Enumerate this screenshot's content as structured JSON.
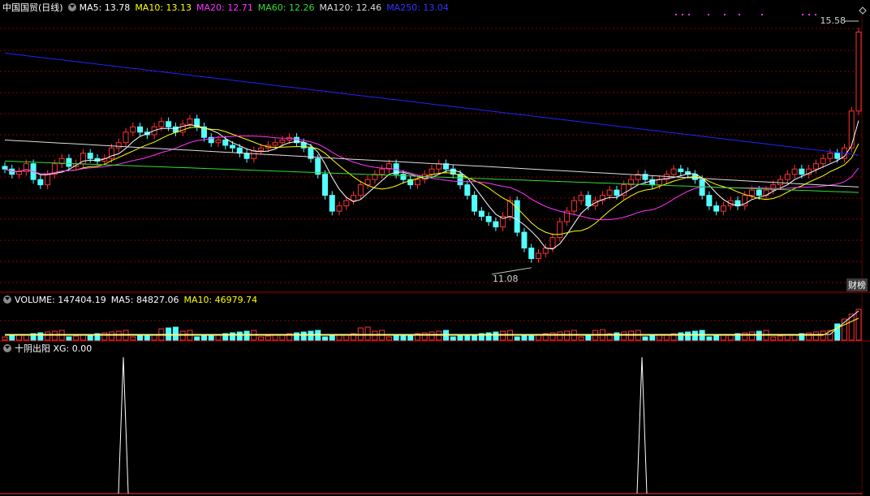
{
  "main_header": {
    "title": "中国国贸(日线)",
    "ma": [
      {
        "label": "MA5: 13.78",
        "color": "#ffffff"
      },
      {
        "label": "MA10: 13.13",
        "color": "#ffff00"
      },
      {
        "label": "MA20: 12.71",
        "color": "#ff33ff"
      },
      {
        "label": "MA60: 12.26",
        "color": "#33dd33"
      },
      {
        "label": "MA120: 12.46",
        "color": "#dddddd"
      },
      {
        "label": "MA250: 13.04",
        "color": "#3333ff"
      }
    ]
  },
  "price_labels": {
    "high": "15.58",
    "low": "11.08"
  },
  "badge": "财榜",
  "volume_header": {
    "items": [
      {
        "label": "VOLUME: 147404.19",
        "color": "#ffffff"
      },
      {
        "label": "MA5: 84827.06",
        "color": "#ffffff"
      },
      {
        "label": "MA10: 46979.74",
        "color": "#ffff00"
      }
    ]
  },
  "indicator_header": {
    "label": "十阴出阳 XG: 0.00"
  },
  "colors": {
    "up": "#ff3232",
    "down": "#54ffff",
    "grid": "#8b0000",
    "ma5": "#ffffff",
    "ma10": "#ffff00",
    "ma20": "#ff33ff",
    "ma60": "#33dd33",
    "ma120": "#dddddd",
    "ma250": "#2222ff"
  },
  "chart_data": {
    "type": "line",
    "title": "中国国贸(日线)",
    "series_summary": [
      {
        "name": "MA5",
        "last": 13.78
      },
      {
        "name": "MA10",
        "last": 13.13
      },
      {
        "name": "MA20",
        "last": 12.71
      },
      {
        "name": "MA60",
        "last": 12.26
      },
      {
        "name": "MA120",
        "last": 12.46
      },
      {
        "name": "MA250",
        "last": 13.04
      }
    ],
    "annotated_high": 15.58,
    "annotated_low": 11.08,
    "closes": [
      12.8,
      12.7,
      12.75,
      12.9,
      12.6,
      12.5,
      12.7,
      12.9,
      13.0,
      12.85,
      12.9,
      13.1,
      13.0,
      12.95,
      13.0,
      13.2,
      13.3,
      13.5,
      13.6,
      13.5,
      13.45,
      13.6,
      13.7,
      13.6,
      13.5,
      13.65,
      13.75,
      13.6,
      13.4,
      13.3,
      13.35,
      13.25,
      13.2,
      13.1,
      13.0,
      13.15,
      13.2,
      13.25,
      13.3,
      13.35,
      13.4,
      13.3,
      13.2,
      13.0,
      12.7,
      12.3,
      12.0,
      12.1,
      12.2,
      12.3,
      12.5,
      12.6,
      12.7,
      12.8,
      12.9,
      12.7,
      12.6,
      12.5,
      12.6,
      12.7,
      12.8,
      12.9,
      12.8,
      12.7,
      12.5,
      12.3,
      12.0,
      11.9,
      11.8,
      11.7,
      11.9,
      12.2,
      11.6,
      11.3,
      11.1,
      11.2,
      11.3,
      11.5,
      11.8,
      12.0,
      12.2,
      12.3,
      12.1,
      12.2,
      12.3,
      12.4,
      12.3,
      12.5,
      12.6,
      12.7,
      12.6,
      12.5,
      12.6,
      12.7,
      12.8,
      12.75,
      12.7,
      12.6,
      12.3,
      12.1,
      12.0,
      12.1,
      12.2,
      12.1,
      12.3,
      12.4,
      12.3,
      12.4,
      12.5,
      12.6,
      12.7,
      12.8,
      12.7,
      12.8,
      12.9,
      13.0,
      13.1,
      13.0,
      13.2,
      13.9,
      15.4
    ],
    "volume_summary": {
      "volume": 147404.19,
      "ma5": 84827.06,
      "ma10": 46979.74
    },
    "indicator": {
      "name": "十阴出阳 XG",
      "value": 0.0
    }
  }
}
